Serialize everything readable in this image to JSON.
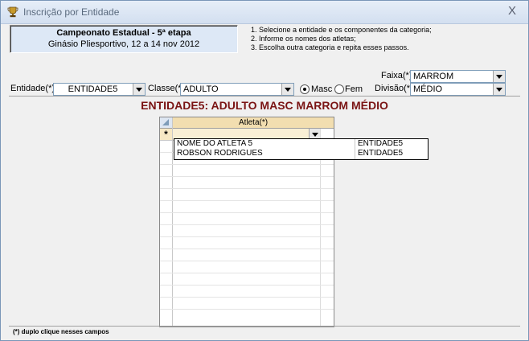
{
  "window": {
    "title": "Inscrição por Entidade",
    "close_label": "X"
  },
  "header": {
    "line1": "Campeonato Estadual - 5ª etapa",
    "line2": "Ginásio Pliesportivo, 12 a 14 nov 2012"
  },
  "instructions": [
    "1. Selecione a entidade e os componentes da categoria;",
    "2. Informe os nomes dos atletas;",
    "3. Escolha outra categoria e repita esses passos."
  ],
  "form": {
    "faixa_label": "Faixa(*):",
    "faixa_value": "MARROM",
    "entidade_label": "Entidade(*):",
    "entidade_value": "ENTIDADE5",
    "classe_label": "Classe(*):",
    "classe_value": "ADULTO",
    "masc_label": "Masc",
    "fem_label": "Fem",
    "divisao_label": "Divisão(*):",
    "divisao_value": "MÉDIO"
  },
  "heading": "ENTIDADE5: ADULTO MASC MARROM MÉDIO",
  "grid": {
    "column_header": "Atleta(*)",
    "new_row_marker": "*"
  },
  "dropdown": {
    "rows": [
      {
        "name": "NOME DO ATLETA 5",
        "entity": "ENTIDADE5"
      },
      {
        "name": "ROBSON RODRIGUES",
        "entity": "ENTIDADE5"
      }
    ]
  },
  "status": "(*) duplo clique nesses campos"
}
